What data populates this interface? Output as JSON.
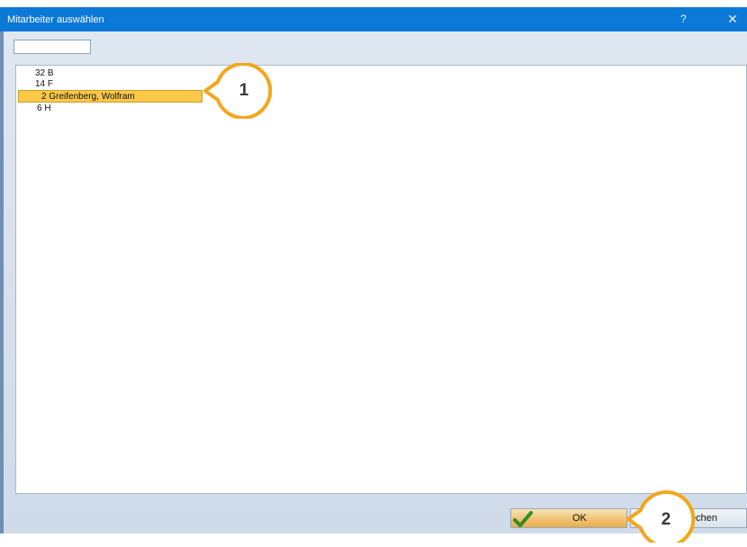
{
  "dialog": {
    "title": "Mitarbeiter auswählen",
    "help_label": "?",
    "close_label": "✕"
  },
  "search": {
    "value": ""
  },
  "list": {
    "items": [
      {
        "label": "32 B",
        "selected": false
      },
      {
        "label": "14 F",
        "selected": false
      },
      {
        "label": "2 Greifenberg, Wolfram",
        "selected": true
      },
      {
        "label": "6 H",
        "selected": false
      }
    ]
  },
  "buttons": {
    "ok_label": "OK",
    "cancel_label_visible": "echen"
  },
  "callouts": {
    "one": "1",
    "two": "2"
  },
  "colors": {
    "titlebar": "#0c78d8",
    "selection": "#fbc84a",
    "callout_ring": "#f3a71c",
    "check": "#2f8f1f"
  }
}
